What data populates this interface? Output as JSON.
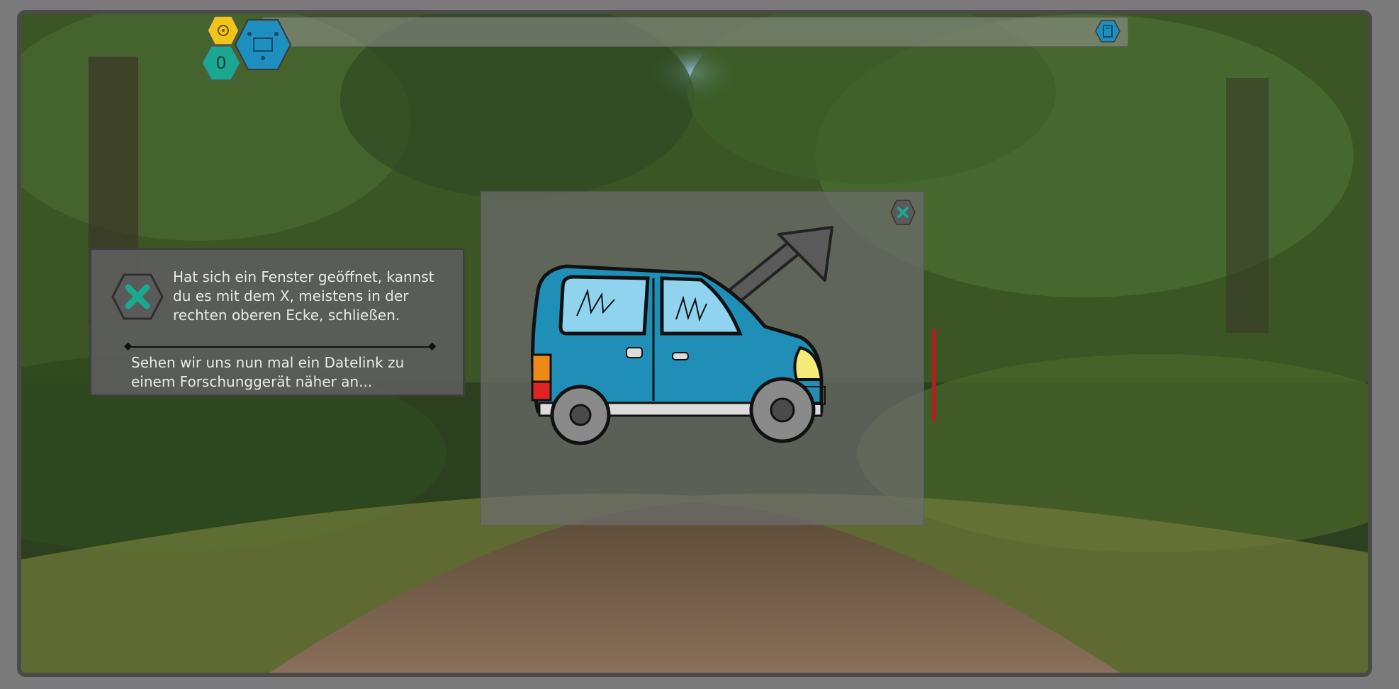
{
  "topbar": {
    "score_value": "0",
    "icons": [
      "gear-chip-icon",
      "circuit-map-icon",
      "book-icon"
    ]
  },
  "hint_box": {
    "text_line1": "Hat sich ein Fenster geöffnet, kannst",
    "text_line2": "du es mit dem X, meistens in der",
    "text_line3": "rechten oberen Ecke, schließen.",
    "next_line1": "Sehen wir uns nun mal ein Datelink zu",
    "next_line2": "einem Forschunggerät näher an..."
  },
  "colors": {
    "accent_teal": "#1aa890",
    "accent_blue": "#1f8fbf",
    "accent_yellow": "#f0c419",
    "car_blue": "#1f8fb8"
  }
}
